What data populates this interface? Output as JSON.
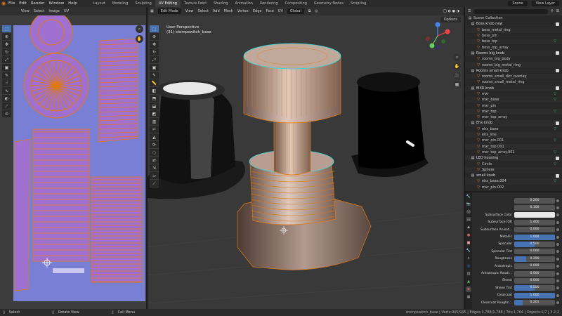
{
  "menu": {
    "items": [
      "File",
      "Edit",
      "Render",
      "Window",
      "Help"
    ]
  },
  "workspace_tabs": {
    "items": [
      "Layout",
      "Modeling",
      "Sculpting",
      "UV Editing",
      "Texture Paint",
      "Shading",
      "Animation",
      "Rendering",
      "Compositing",
      "Geometry Nodes",
      "Scripting"
    ],
    "active_index": 3
  },
  "top_right": {
    "scene": "Scene",
    "view_layer": "View Layer"
  },
  "uv_header": {
    "items": [
      "View",
      "Select",
      "Image",
      "UV"
    ]
  },
  "viewport_header": {
    "mode": "Edit Mode",
    "items": [
      "View",
      "Select",
      "Add",
      "Mesh",
      "Vertex",
      "Edge",
      "Face",
      "UV"
    ],
    "transform": "Global",
    "options": "Options"
  },
  "viewport": {
    "perspective": "User Perspective",
    "object_label": "(31) stompswitch_base"
  },
  "outliner": {
    "root": "Scene Collection",
    "rows": [
      {
        "label": "Boss knob new",
        "kind": "collection",
        "checked": true
      },
      {
        "label": "boss_metal_ring",
        "kind": "mesh"
      },
      {
        "label": "boss_pin",
        "kind": "mesh"
      },
      {
        "label": "boss_top",
        "kind": "mesh",
        "tri": true
      },
      {
        "label": "boss_top_array",
        "kind": "mesh"
      },
      {
        "label": "Rooms big knob",
        "kind": "collection",
        "checked": true
      },
      {
        "label": "rooms_big_body",
        "kind": "mesh"
      },
      {
        "label": "rooms_big_metal_ring",
        "kind": "mesh"
      },
      {
        "label": "Rooms small knob",
        "kind": "collection",
        "checked": true
      },
      {
        "label": "rooms_small_dirt_overlay",
        "kind": "mesh"
      },
      {
        "label": "rooms_small_metal_ring",
        "kind": "mesh"
      },
      {
        "label": "MXR knob",
        "kind": "collection",
        "checked": true
      },
      {
        "label": "mxr",
        "kind": "mesh",
        "tri": true
      },
      {
        "label": "mxr_base",
        "kind": "mesh",
        "tri": true
      },
      {
        "label": "mxr_pin",
        "kind": "mesh"
      },
      {
        "label": "mxr_top",
        "kind": "mesh",
        "tri": true
      },
      {
        "label": "mxr_top_array",
        "kind": "mesh"
      },
      {
        "label": "Ehx knob",
        "kind": "collection",
        "checked": true
      },
      {
        "label": "ehx_base",
        "kind": "mesh",
        "tri": true
      },
      {
        "label": "ehx_line",
        "kind": "mesh"
      },
      {
        "label": "mxr_pin.001",
        "kind": "mesh",
        "tri": true
      },
      {
        "label": "mxr_top.001",
        "kind": "mesh"
      },
      {
        "label": "mxr_top_array.001",
        "kind": "mesh",
        "tri": true
      },
      {
        "label": "LED housing",
        "kind": "collection",
        "checked": true
      },
      {
        "label": "Circle",
        "kind": "mesh",
        "tri": true
      },
      {
        "label": "Sphere",
        "kind": "mesh"
      },
      {
        "label": "small knob",
        "kind": "collection",
        "checked": true
      },
      {
        "label": "ehx_base.004",
        "kind": "mesh",
        "tri": true
      },
      {
        "label": "mxr_pin.002",
        "kind": "mesh"
      }
    ]
  },
  "properties": {
    "rows": [
      {
        "label": "",
        "value": "0.200",
        "style": "plain"
      },
      {
        "label": "",
        "value": "0.100",
        "style": "plain"
      },
      {
        "label": "Subsurface Color",
        "value": "",
        "style": "color"
      },
      {
        "label": "Subsurface IOR",
        "value": "1.400",
        "style": "plain"
      },
      {
        "label": "Subsurface Anisot...",
        "value": "0.000",
        "style": "plain"
      },
      {
        "label": "Metallic",
        "value": "1.000",
        "style": "blue"
      },
      {
        "label": "Specular",
        "value": "0.500",
        "style": "half"
      },
      {
        "label": "Specular Tint",
        "value": "0.000",
        "style": "plain"
      },
      {
        "label": "Roughness",
        "value": "0.299",
        "style": "third"
      },
      {
        "label": "Anisotropic",
        "value": "0.000",
        "style": "plain"
      },
      {
        "label": "Anisotropic Rotati...",
        "value": "0.000",
        "style": "plain"
      },
      {
        "label": "Sheen",
        "value": "0.000",
        "style": "plain"
      },
      {
        "label": "Sheen Tint",
        "value": "0.500",
        "style": "half"
      },
      {
        "label": "Clearcoat",
        "value": "1.000",
        "style": "blue"
      },
      {
        "label": "Clearcoat Roughn...",
        "value": "0.201",
        "style": "fifth"
      }
    ]
  },
  "status": {
    "select": "Select",
    "rotate": "Rotate View",
    "call_menu": "Call Menu",
    "info": "stompswitch_base | Verts:945/945 | Edges:1,788/1,788 | Tris:1,764 | Objects:1/7 | 3.2.2"
  }
}
